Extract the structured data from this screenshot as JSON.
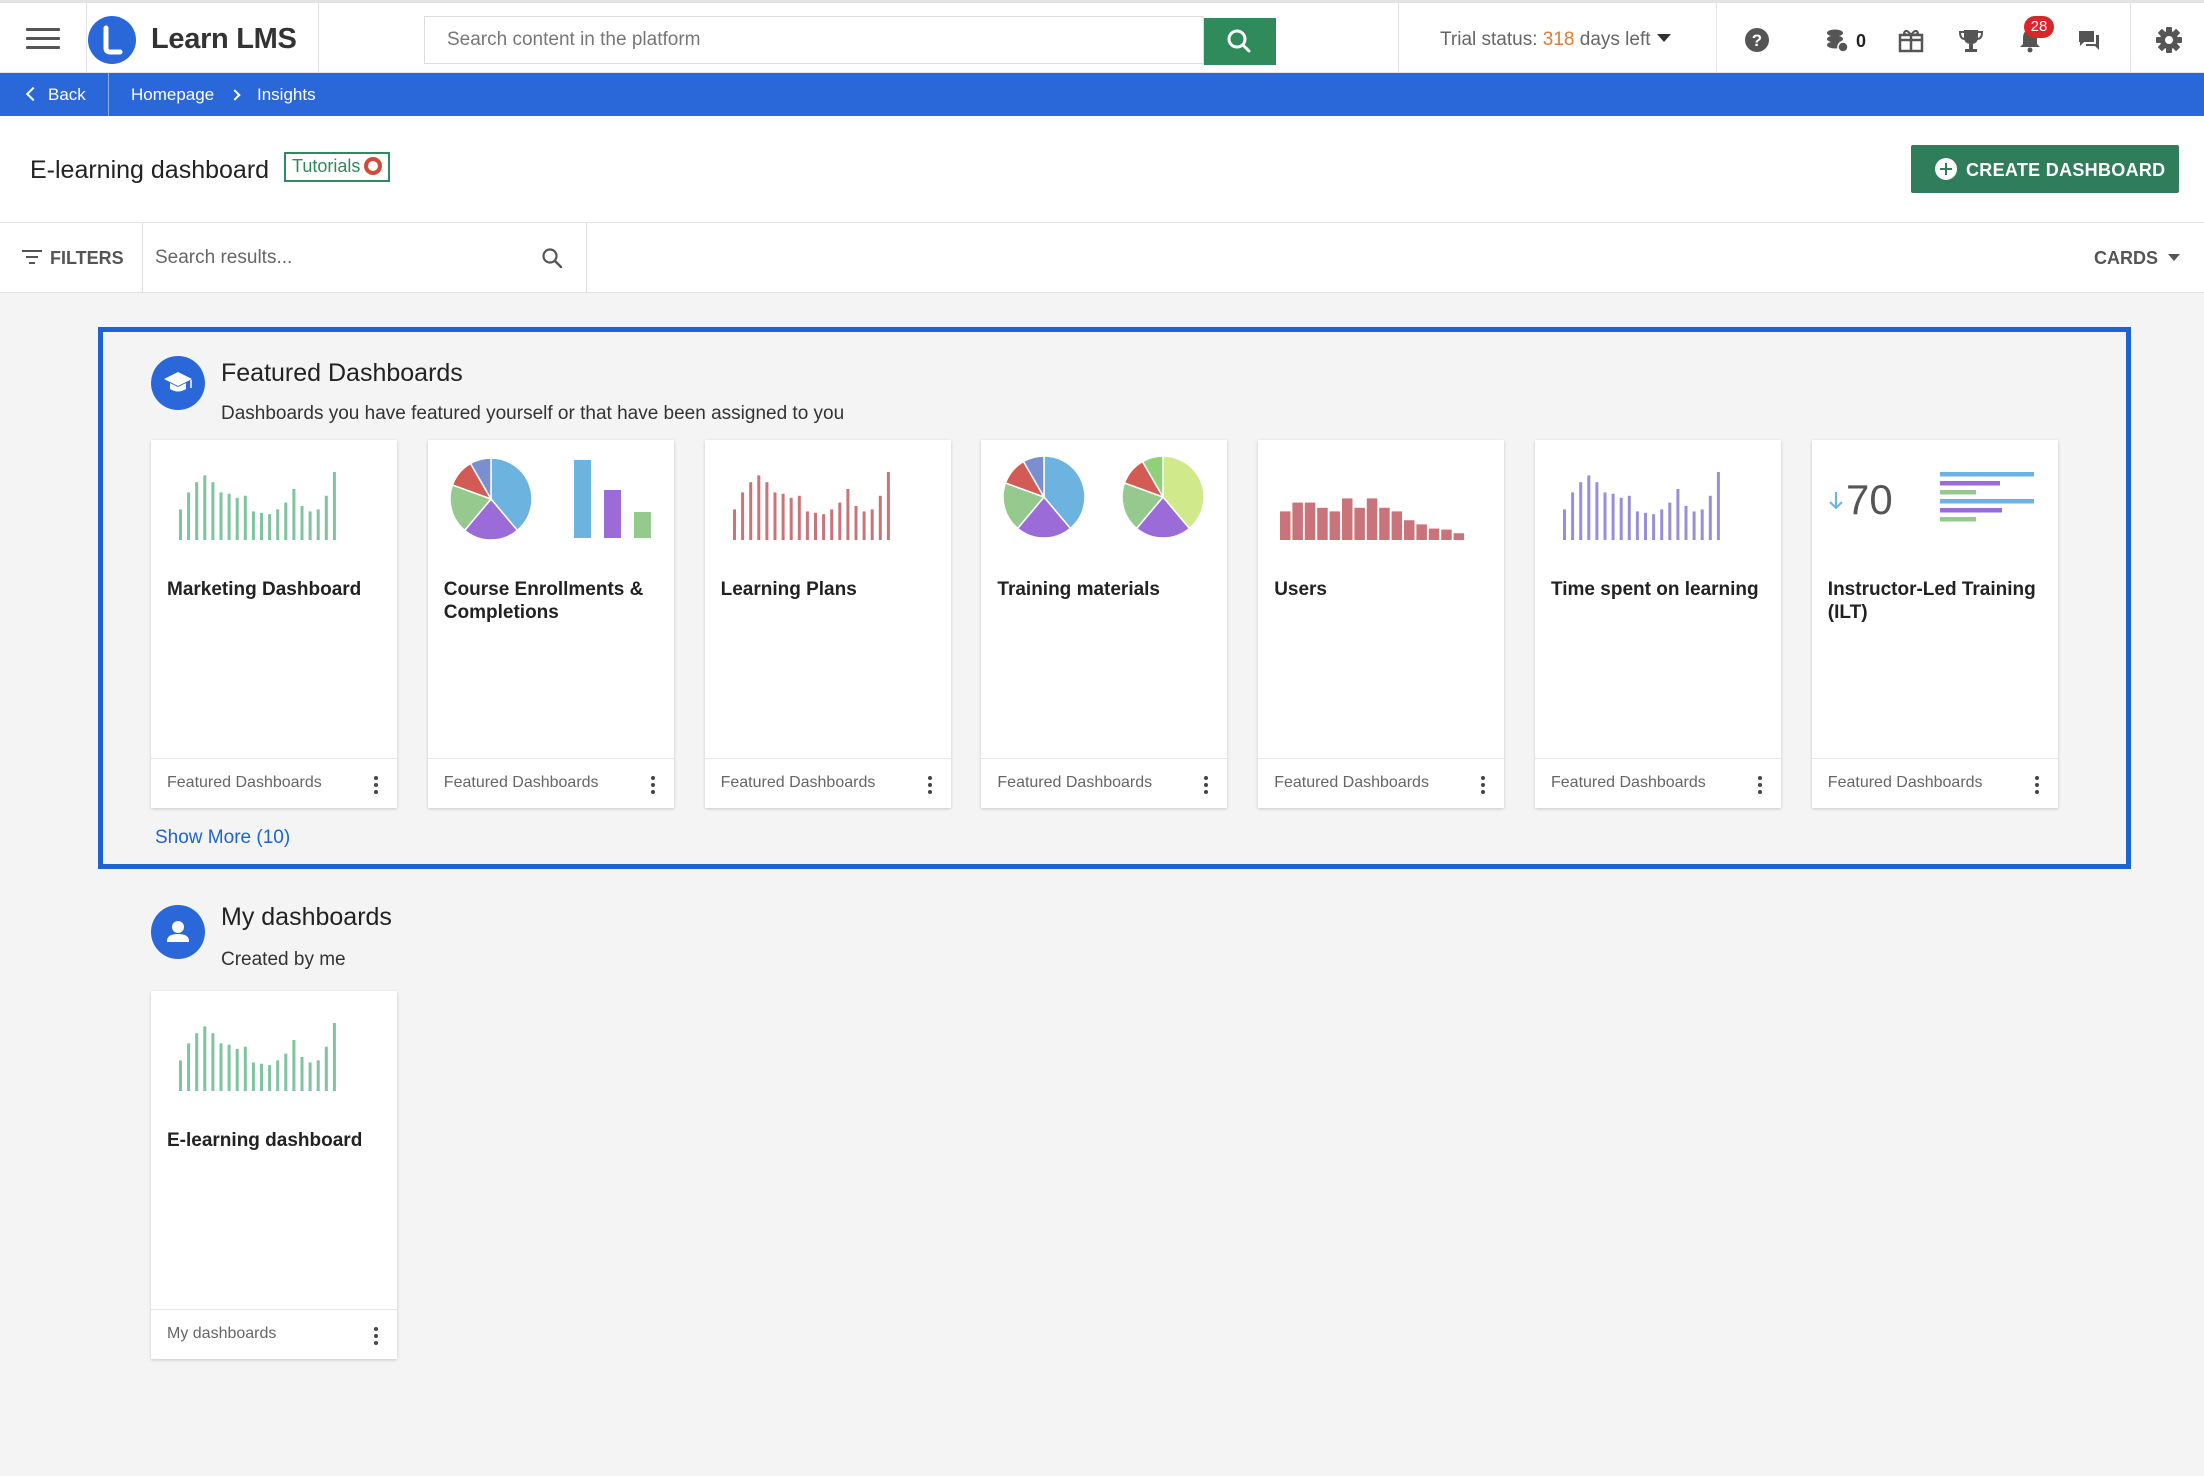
{
  "app": {
    "name": "Learn LMS",
    "search_placeholder": "Search content in the platform",
    "trial_prefix": "Trial status:",
    "trial_days": "318",
    "trial_suffix": "days left",
    "coins": "0",
    "notifications": "28"
  },
  "breadcrumb": {
    "back": "Back",
    "items": [
      "Homepage",
      "Insights"
    ]
  },
  "header": {
    "title": "E-learning dashboard",
    "tutorials": "Tutorials",
    "create_button": "CREATE DASHBOARD"
  },
  "filterbar": {
    "filters_label": "FILTERS",
    "search_placeholder": "Search results...",
    "view": "CARDS"
  },
  "featured": {
    "title": "Featured Dashboards",
    "subtitle": "Dashboards you have featured yourself or that have been assigned to you",
    "show_more": "Show More (10)",
    "cards": [
      {
        "title": "Marketing Dashboard",
        "footer": "Featured Dashboards",
        "thumb": "bars-green"
      },
      {
        "title": "Course Enrollments & Completions",
        "footer": "Featured Dashboards",
        "thumb": "pie-bars"
      },
      {
        "title": "Learning Plans",
        "footer": "Featured Dashboards",
        "thumb": "bars-red"
      },
      {
        "title": "Training materials",
        "footer": "Featured Dashboards",
        "thumb": "two-pies"
      },
      {
        "title": "Users",
        "footer": "Featured Dashboards",
        "thumb": "blocks-red"
      },
      {
        "title": "Time spent on learning",
        "footer": "Featured Dashboards",
        "thumb": "bars-purple"
      },
      {
        "title": "Instructor-Led Training (ILT)",
        "footer": "Featured Dashboards",
        "thumb": "kpi-hbars",
        "kpi": "70"
      }
    ]
  },
  "mine": {
    "title": "My dashboards",
    "subtitle": "Created by me",
    "cards": [
      {
        "title": "E-learning dashboard",
        "footer": "My dashboards",
        "thumb": "bars-green"
      }
    ]
  },
  "colors": {
    "brand_blue": "#2a67d8",
    "green": "#2f8a5c",
    "bar_green": "#7fc3a0",
    "bar_red": "#c9737a",
    "bar_purple": "#9a8fd6",
    "pie_blue": "#6db3e0",
    "pie_purple": "#9b6cd8",
    "pie_green": "#95c98e",
    "pie_red": "#d25b55",
    "pie_lime": "#cfe98b",
    "trial_orange": "#e07a2f"
  }
}
